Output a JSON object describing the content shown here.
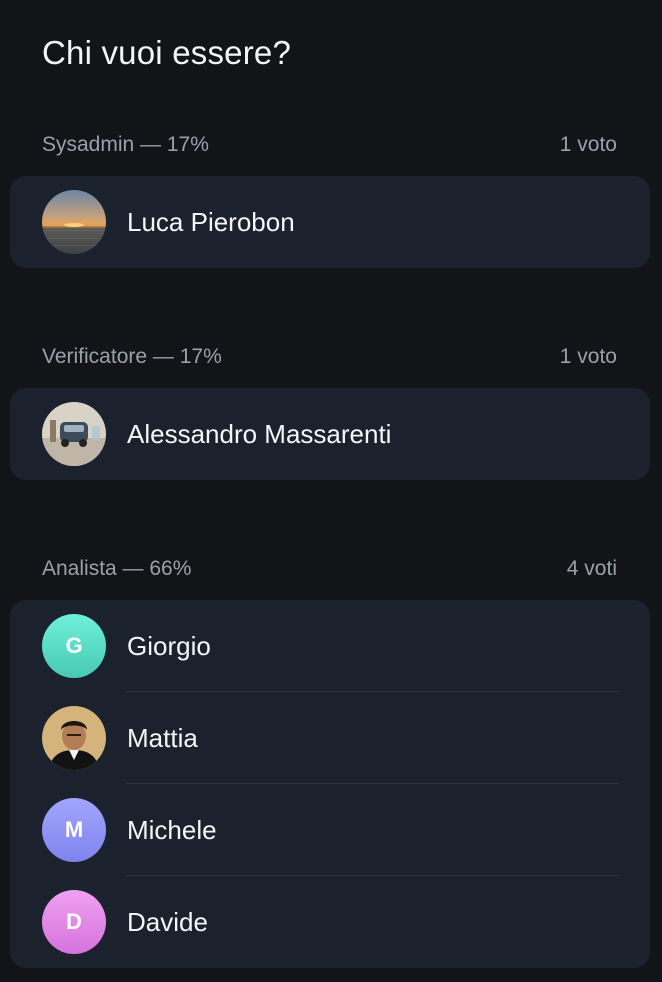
{
  "poll": {
    "title": "Chi vuoi essere?",
    "options": [
      {
        "label": "Sysadmin — 17%",
        "votes": "1 voto",
        "voters": [
          {
            "name": "Luca Pierobon",
            "avatar": "photo-sunset-sea"
          }
        ]
      },
      {
        "label": "Verificatore — 17%",
        "votes": "1 voto",
        "voters": [
          {
            "name": "Alessandro Massarenti",
            "avatar": "photo-car"
          }
        ]
      },
      {
        "label": "Analista — 66%",
        "votes": "4 voti",
        "voters": [
          {
            "name": "Giorgio",
            "initial": "G",
            "color": "#5ee0c8"
          },
          {
            "name": "Mattia",
            "avatar": "photo-portrait"
          },
          {
            "name": "Michele",
            "initial": "M",
            "color": "#8e93f5"
          },
          {
            "name": "Davide",
            "initial": "D",
            "color": "#e488e8"
          }
        ]
      }
    ]
  }
}
